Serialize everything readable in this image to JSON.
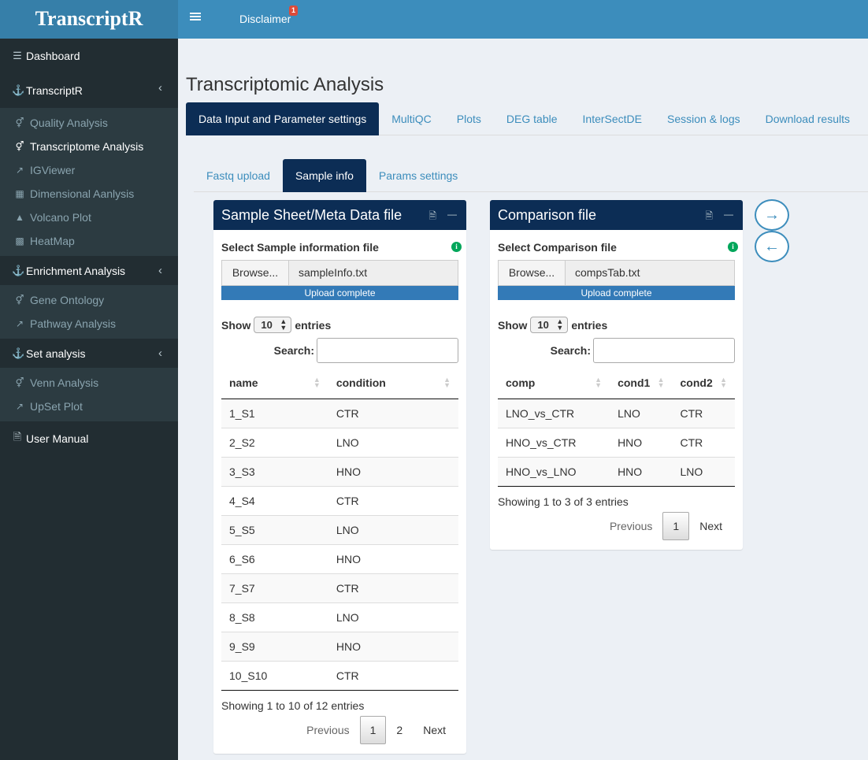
{
  "app": {
    "title": "TranscriptR"
  },
  "navbar": {
    "disclaimer_label": "Disclaimer",
    "disclaimer_badge": "1"
  },
  "sidebar": {
    "dashboard": "Dashboard",
    "transcriptr": "TranscriptR",
    "transcriptr_items": [
      "Quality Analysis",
      "Transcriptome Analysis",
      "IGViewer",
      "Dimensional Aanlysis",
      "Volcano Plot",
      "HeatMap"
    ],
    "enrichment": "Enrichment Analysis",
    "enrichment_items": [
      "Gene Ontology",
      "Pathway Analysis"
    ],
    "set_analysis": "Set analysis",
    "set_items": [
      "Venn Analysis",
      "UpSet Plot"
    ],
    "user_manual": "User Manual"
  },
  "main": {
    "title": "Transcriptomic Analysis",
    "tabs": [
      "Data Input and Parameter settings",
      "MultiQC",
      "Plots",
      "DEG table",
      "InterSectDE",
      "Session & logs",
      "Download results"
    ],
    "subtabs": [
      "Fastq upload",
      "Sample info",
      "Params settings"
    ]
  },
  "sample_box": {
    "title": "Sample Sheet/Meta Data file",
    "file_label": "Select Sample information file",
    "browse": "Browse...",
    "file_name": "sampleInfo.txt",
    "progress": "Upload complete",
    "show": "Show",
    "entries_value": "10",
    "entries": "entries",
    "search": "Search:",
    "columns": [
      "name",
      "condition"
    ],
    "rows": [
      [
        "1_S1",
        "CTR"
      ],
      [
        "2_S2",
        "LNO"
      ],
      [
        "3_S3",
        "HNO"
      ],
      [
        "4_S4",
        "CTR"
      ],
      [
        "5_S5",
        "LNO"
      ],
      [
        "6_S6",
        "HNO"
      ],
      [
        "7_S7",
        "CTR"
      ],
      [
        "8_S8",
        "LNO"
      ],
      [
        "9_S9",
        "HNO"
      ],
      [
        "10_S10",
        "CTR"
      ]
    ],
    "info": "Showing 1 to 10 of 12 entries",
    "pager": {
      "previous": "Previous",
      "pages": [
        "1",
        "2"
      ],
      "next": "Next"
    }
  },
  "comparison_box": {
    "title": "Comparison file",
    "file_label": "Select Comparison file",
    "browse": "Browse...",
    "file_name": "compsTab.txt",
    "progress": "Upload complete",
    "show": "Show",
    "entries_value": "10",
    "entries": "entries",
    "search": "Search:",
    "columns": [
      "comp",
      "cond1",
      "cond2"
    ],
    "rows": [
      [
        "LNO_vs_CTR",
        "LNO",
        "CTR"
      ],
      [
        "HNO_vs_CTR",
        "HNO",
        "CTR"
      ],
      [
        "HNO_vs_LNO",
        "HNO",
        "LNO"
      ]
    ],
    "info": "Showing 1 to 3 of 3 entries",
    "pager": {
      "previous": "Previous",
      "pages": [
        "1"
      ],
      "next": "Next"
    }
  },
  "nav_buttons": {
    "forward": "→",
    "back": "←"
  },
  "icons": {
    "hamburger": "bars-icon",
    "dashboard": "database-icon",
    "anchor": "anchor-icon",
    "info": "info-icon",
    "pdf": "file-pdf-icon",
    "minus": "minus-icon"
  },
  "colors": {
    "header": "#3c8dbc",
    "logo": "#367fa9",
    "sidebar": "#222d32",
    "box_header": "#0c2d55",
    "accent": "#3c8dbc"
  }
}
